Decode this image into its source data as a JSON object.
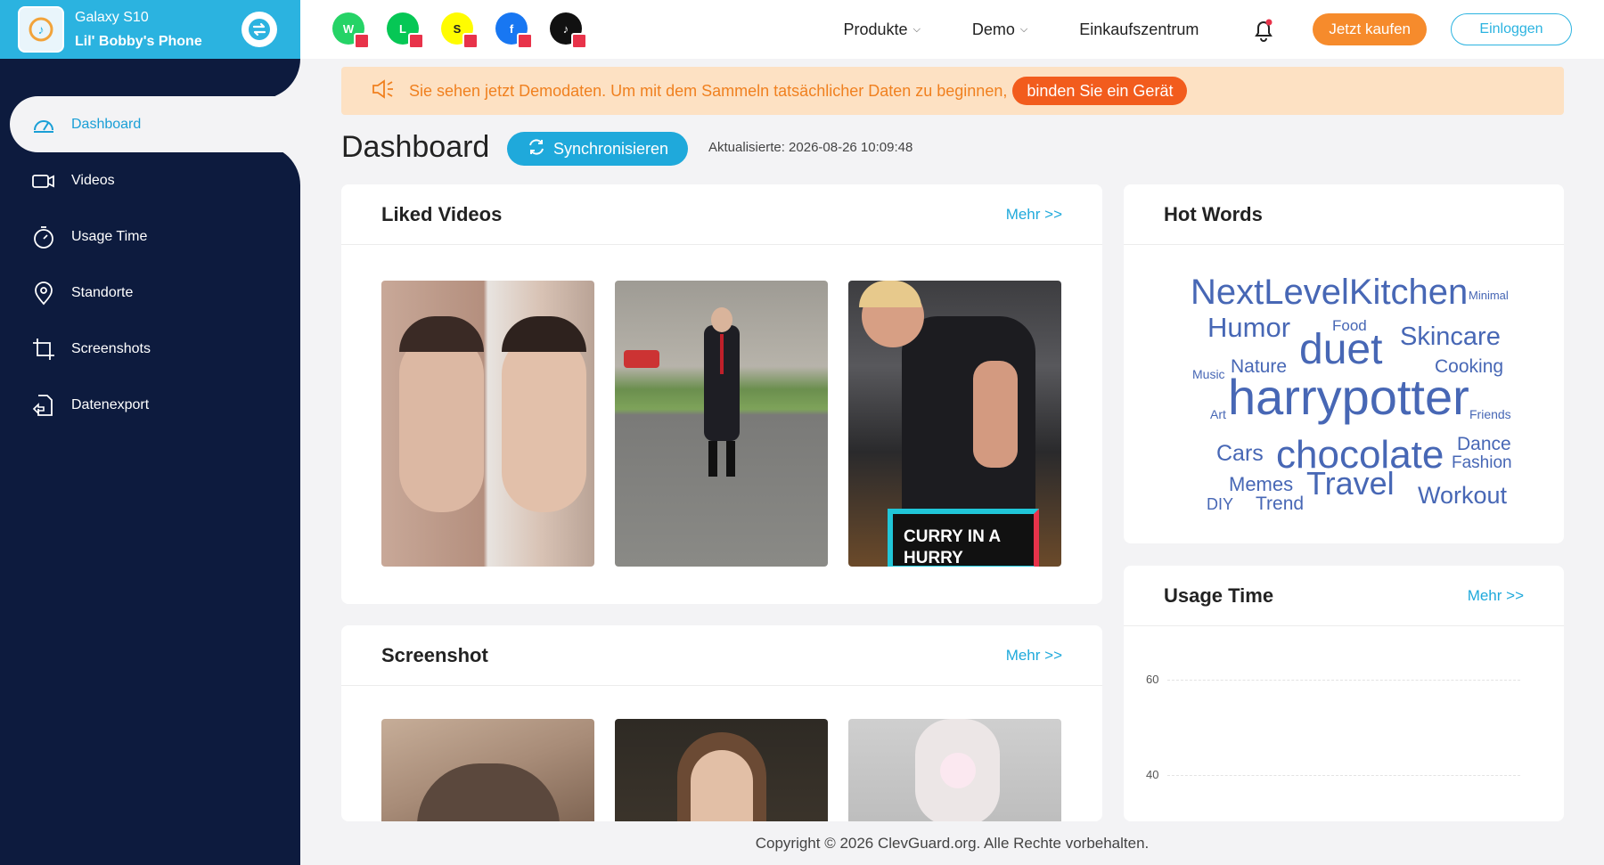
{
  "device": {
    "model": "Galaxy S10",
    "name": "Lil' Bobby's Phone"
  },
  "sidebar": {
    "items": [
      {
        "label": "Dashboard",
        "icon": "gauge-icon",
        "active": true
      },
      {
        "label": "Videos",
        "icon": "video-icon"
      },
      {
        "label": "Usage Time",
        "icon": "stopwatch-icon"
      },
      {
        "label": "Standorte",
        "icon": "location-pin-icon"
      },
      {
        "label": "Screenshots",
        "icon": "crop-icon"
      },
      {
        "label": "Datenexport",
        "icon": "export-icon"
      }
    ]
  },
  "topbar": {
    "apps": [
      "whatsapp-icon",
      "line-icon",
      "snapchat-icon",
      "facebook-icon",
      "tiktok-icon"
    ],
    "menu_produkte": "Produkte",
    "menu_demo": "Demo",
    "menu_mall": "Einkaufszentrum",
    "buy_label": "Jetzt kaufen",
    "login_label": "Einloggen"
  },
  "notice": {
    "text": "Sie sehen jetzt Demodaten. Um mit dem Sammeln tatsächlicher Daten zu beginnen,",
    "link": "binden Sie ein Gerät"
  },
  "header": {
    "title": "Dashboard",
    "sync_label": "Synchronisieren",
    "updated": "Aktualisierte: 2026-08-26 10:09:48"
  },
  "liked": {
    "title": "Liked Videos",
    "more": "Mehr >>",
    "overlay_text": "CURRY IN A HURRY"
  },
  "screenshots": {
    "title": "Screenshot",
    "more": "Mehr >>"
  },
  "hotwords": {
    "title": "Hot Words",
    "words": [
      "NextLevelKitchen",
      "Minimal",
      "Humor",
      "Food",
      "duet",
      "Skincare",
      "Music",
      "Nature",
      "Cooking",
      "Art",
      "harrypotter",
      "Friends",
      "Cars",
      "chocolate",
      "Dance",
      "Fashion",
      "Memes",
      "Travel",
      "DIY",
      "Trend",
      "Workout"
    ]
  },
  "usage": {
    "title": "Usage Time",
    "more": "Mehr >>",
    "y_ticks": [
      "60",
      "40"
    ]
  },
  "footer": {
    "copyright": "Copyright © 2026 ClevGuard.org. Alle Rechte vorbehalten."
  },
  "colors": {
    "sidebar": "#0d1b3e",
    "accent": "#1fa9db",
    "orange": "#f68b2c",
    "word": "#4767b5"
  }
}
